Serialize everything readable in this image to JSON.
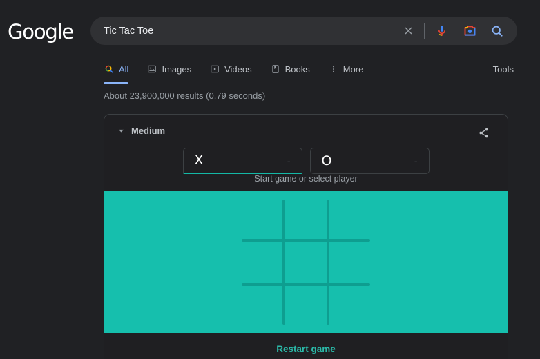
{
  "branding": {
    "logo_text": "Google",
    "logo_color": "#ffffff"
  },
  "search": {
    "query": "Tic Tac Toe",
    "placeholder": "Search",
    "clear_icon": "close-icon",
    "mic_icon": "microphone-icon",
    "lens_icon": "google-lens-camera-icon",
    "search_icon": "magnifier-icon"
  },
  "nav": {
    "tabs": [
      {
        "label": "All",
        "icon": "magnifier-icon",
        "active": true
      },
      {
        "label": "Images",
        "icon": "image-icon",
        "active": false
      },
      {
        "label": "Videos",
        "icon": "video-play-icon",
        "active": false
      },
      {
        "label": "Books",
        "icon": "book-icon",
        "active": false
      },
      {
        "label": "More",
        "icon": "kebab-menu-icon",
        "active": false
      }
    ],
    "tools_label": "Tools"
  },
  "results": {
    "count_text": "About 23,900,000 results (0.79 seconds)"
  },
  "game": {
    "difficulty_label": "Medium",
    "share_icon": "share-icon",
    "caret_icon": "chevron-down-icon",
    "players": [
      {
        "mark": "X",
        "score": "-",
        "selected": true
      },
      {
        "mark": "O",
        "score": "-",
        "selected": false
      }
    ],
    "status_text": "Start game or select player",
    "restart_label": "Restart game",
    "board_color": "#16bfad",
    "grid_color": "#0e9e90",
    "accent_color": "#14b8a6",
    "board_cells": [
      [
        "",
        "",
        ""
      ],
      [
        "",
        "",
        ""
      ],
      [
        "",
        "",
        ""
      ]
    ]
  }
}
